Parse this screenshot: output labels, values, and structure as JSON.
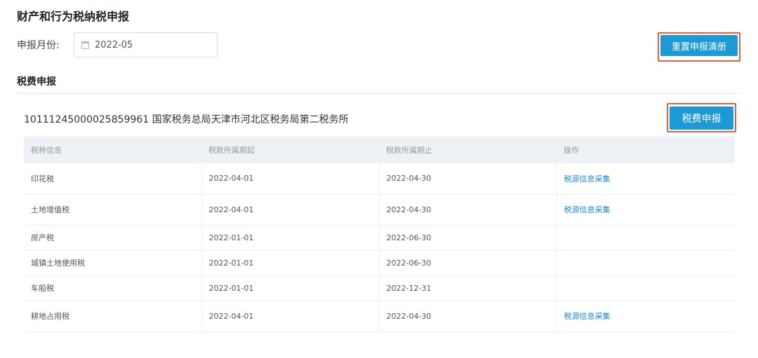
{
  "page_title": "财产和行为税纳税申报",
  "period": {
    "label": "申报月份:",
    "value": "2022-05"
  },
  "buttons": {
    "reset": "重置申报清册",
    "declare": "税费申报"
  },
  "section_title": "税费申报",
  "org_line": "10111245000025859961 国家税务总局天津市河北区税务局第二税务所",
  "table": {
    "headers": [
      "税种信息",
      "税款所属期起",
      "税款所属期止",
      "操作"
    ],
    "rows": [
      {
        "tax": "印花税",
        "start": "2022-04-01",
        "end": "2022-04-30",
        "action": "税源信息采集"
      },
      {
        "tax": "土地增值税",
        "start": "2022-04-01",
        "end": "2022-04-30",
        "action": "税源信息采集"
      },
      {
        "tax": "房产税",
        "start": "2022-01-01",
        "end": "2022-06-30",
        "action": ""
      },
      {
        "tax": "城镇土地使用税",
        "start": "2022-01-01",
        "end": "2022-06-30",
        "action": ""
      },
      {
        "tax": "车船税",
        "start": "2022-01-01",
        "end": "2022-12-31",
        "action": ""
      },
      {
        "tax": "耕地占用税",
        "start": "2022-04-01",
        "end": "2022-04-30",
        "action": "税源信息采集"
      }
    ]
  }
}
